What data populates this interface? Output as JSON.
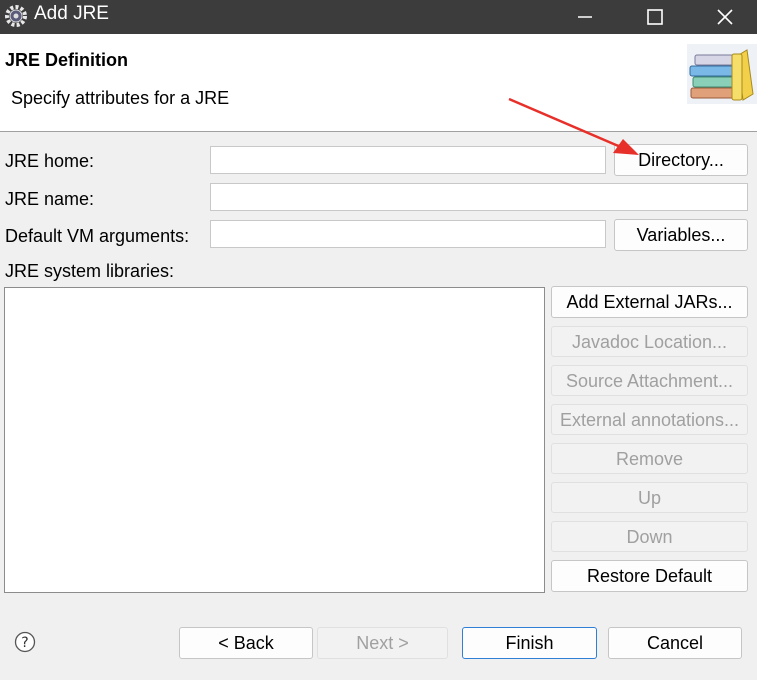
{
  "window": {
    "title": "Add JRE"
  },
  "header": {
    "title": "JRE Definition",
    "subtitle": "Specify attributes for a JRE"
  },
  "form": {
    "jre_home_label": "JRE home:",
    "jre_home_value": "",
    "jre_name_label": "JRE name:",
    "jre_name_value": "",
    "vm_args_label": "Default VM arguments:",
    "vm_args_value": "",
    "libraries_label": "JRE system libraries:",
    "directory_button": "Directory...",
    "variables_button": "Variables..."
  },
  "library_buttons": [
    {
      "label": "Add External JARs...",
      "enabled": true
    },
    {
      "label": "Javadoc Location...",
      "enabled": false
    },
    {
      "label": "Source Attachment...",
      "enabled": false
    },
    {
      "label": "External annotations...",
      "enabled": false
    },
    {
      "label": "Remove",
      "enabled": false
    },
    {
      "label": "Up",
      "enabled": false
    },
    {
      "label": "Down",
      "enabled": false
    },
    {
      "label": "Restore Default",
      "enabled": true
    }
  ],
  "footer": {
    "back": "< Back",
    "next": "Next >",
    "finish": "Finish",
    "cancel": "Cancel"
  },
  "icons": {
    "app": "eclipse-gear-icon",
    "header": "books-icon",
    "help": "help-icon",
    "annotation": "red-arrow"
  },
  "colors": {
    "titlebar": "#3c3c3c",
    "arrow": "#e8302a",
    "primary_border": "#2f7fd6"
  }
}
